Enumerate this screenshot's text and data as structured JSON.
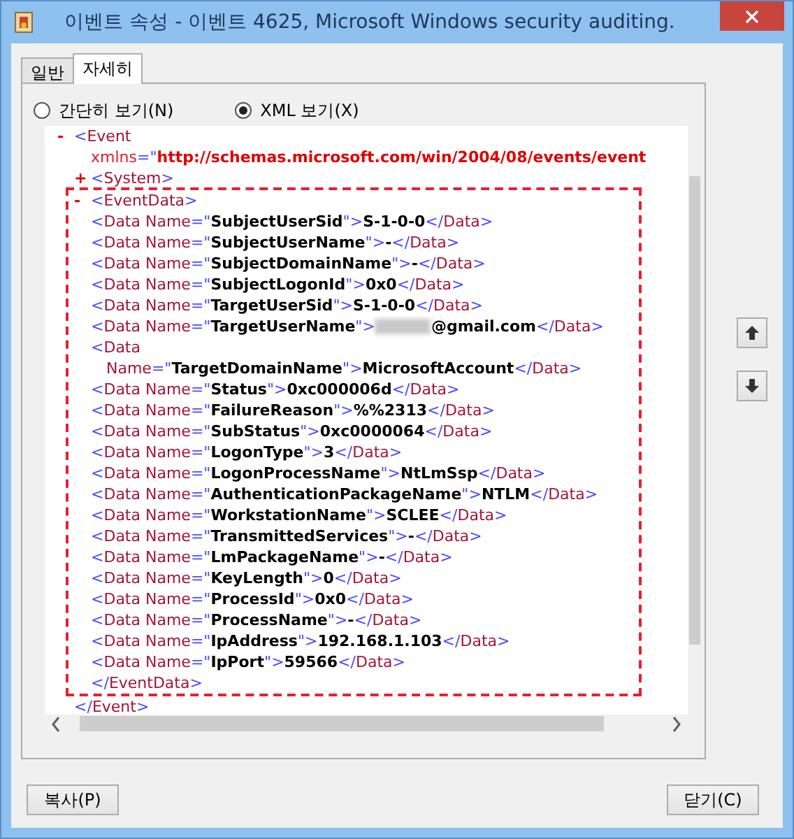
{
  "window": {
    "title": "이벤트 속성 - 이벤트 4625, Microsoft Windows security auditing."
  },
  "tabs": [
    {
      "label": "일반",
      "selected": false
    },
    {
      "label": "자세히",
      "selected": true
    }
  ],
  "view_options": [
    {
      "label": "간단히 보기(N)",
      "selected": false
    },
    {
      "label": "XML 보기(X)",
      "selected": true
    }
  ],
  "xml": {
    "kind": "element",
    "toggle": "-",
    "lines": [
      "<Event",
      "xmlns=\"http://schemas.microsoft.com/win/2004/08/events/event"
    ],
    "close": "</Event>",
    "children": [
      {
        "kind": "element",
        "toggle": "+",
        "lines": [
          "<System>"
        ]
      },
      {
        "kind": "element",
        "toggle": "-",
        "highlighted": true,
        "lines": [
          "<EventData>"
        ],
        "close": "</EventData>",
        "children": [
          {
            "kind": "data",
            "lines": [
              "<Data Name=\"SubjectUserSid\">S-1-0-0</Data>"
            ]
          },
          {
            "kind": "data",
            "lines": [
              "<Data Name=\"SubjectUserName\">-</Data>"
            ]
          },
          {
            "kind": "data",
            "lines": [
              "<Data Name=\"SubjectDomainName\">-</Data>"
            ]
          },
          {
            "kind": "data",
            "lines": [
              "<Data Name=\"SubjectLogonId\">0x0</Data>"
            ]
          },
          {
            "kind": "data",
            "lines": [
              "<Data Name=\"TargetUserSid\">S-1-0-0</Data>"
            ]
          },
          {
            "kind": "data",
            "redacted": true,
            "parts": [
              "<Data Name=\"TargetUserName\">",
              "@gmail.com</Data>"
            ]
          },
          {
            "kind": "data",
            "lines": [
              "<Data",
              "Name=\"TargetDomainName\">MicrosoftAccount</Data>"
            ]
          },
          {
            "kind": "data",
            "lines": [
              "<Data Name=\"Status\">0xc000006d</Data>"
            ]
          },
          {
            "kind": "data",
            "lines": [
              "<Data Name=\"FailureReason\">%%2313</Data>"
            ]
          },
          {
            "kind": "data",
            "lines": [
              "<Data Name=\"SubStatus\">0xc0000064</Data>"
            ]
          },
          {
            "kind": "data",
            "lines": [
              "<Data Name=\"LogonType\">3</Data>"
            ]
          },
          {
            "kind": "data",
            "lines": [
              "<Data Name=\"LogonProcessName\">NtLmSsp</Data>"
            ]
          },
          {
            "kind": "data",
            "lines": [
              "<Data Name=\"AuthenticationPackageName\">NTLM</Data>"
            ]
          },
          {
            "kind": "data",
            "lines": [
              "<Data Name=\"WorkstationName\">SCLEE</Data>"
            ]
          },
          {
            "kind": "data",
            "lines": [
              "<Data Name=\"TransmittedServices\">-</Data>"
            ]
          },
          {
            "kind": "data",
            "lines": [
              "<Data Name=\"LmPackageName\">-</Data>"
            ]
          },
          {
            "kind": "data",
            "lines": [
              "<Data Name=\"KeyLength\">0</Data>"
            ]
          },
          {
            "kind": "data",
            "lines": [
              "<Data Name=\"ProcessId\">0x0</Data>"
            ]
          },
          {
            "kind": "data",
            "lines": [
              "<Data Name=\"ProcessName\">-</Data>"
            ]
          },
          {
            "kind": "data",
            "lines": [
              "<Data Name=\"IpAddress\">192.168.1.103</Data>"
            ]
          },
          {
            "kind": "data",
            "lines": [
              "<Data Name=\"IpPort\">59566</Data>"
            ]
          }
        ]
      }
    ]
  },
  "buttons": [
    {
      "label": "복사(P)"
    },
    {
      "label": "닫기(C)"
    }
  ]
}
